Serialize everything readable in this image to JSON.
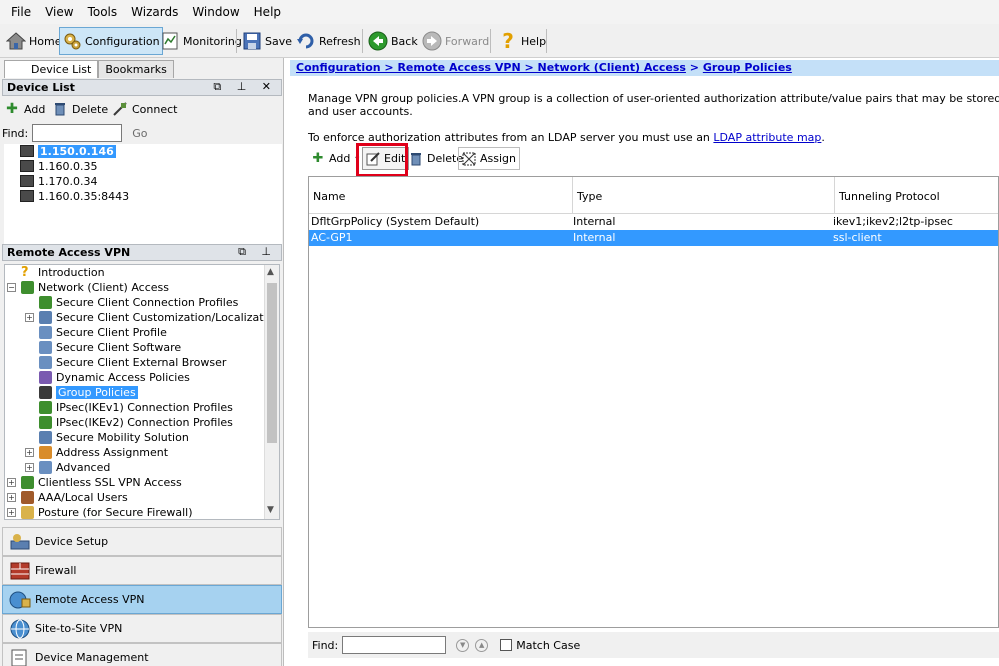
{
  "menu": [
    "File",
    "View",
    "Tools",
    "Wizards",
    "Window",
    "Help"
  ],
  "toolbar": {
    "home": "Home",
    "configuration": "Configuration",
    "monitoring": "Monitoring",
    "save": "Save",
    "refresh": "Refresh",
    "back": "Back",
    "forward": "Forward",
    "help": "Help"
  },
  "left": {
    "tabs": [
      "Device List",
      "Bookmarks"
    ],
    "device_list_title": "Device List",
    "add": "Add",
    "delete": "Delete",
    "connect": "Connect",
    "find_label": "Find:",
    "go": "Go",
    "devices": [
      "1.150.0.146",
      "1.160.0.35",
      "1.170.0.34",
      "1.160.0.35:8443"
    ],
    "rav_title": "Remote Access VPN",
    "tree": [
      "Introduction",
      "Network (Client) Access",
      "Secure Client Connection Profiles",
      "Secure Client Customization/Localization",
      "Secure Client Profile",
      "Secure Client Software",
      "Secure Client External Browser",
      "Dynamic Access Policies",
      "Group Policies",
      "IPsec(IKEv1) Connection Profiles",
      "IPsec(IKEv2) Connection Profiles",
      "Secure Mobility Solution",
      "Address Assignment",
      "Advanced",
      "Clientless SSL VPN Access",
      "AAA/Local Users",
      "Posture (for Secure Firewall)"
    ],
    "nav": [
      "Device Setup",
      "Firewall",
      "Remote Access VPN",
      "Site-to-Site VPN",
      "Device Management"
    ]
  },
  "right": {
    "crumb_path": "Configuration > Remote Access VPN > Network (Client) Access",
    "crumb_sep": " > ",
    "crumb_current": "Group Policies",
    "desc_line1": "Manage VPN group policies.A VPN group is a collection of user-oriented authorization attribute/value pairs that may be stored internally on the device or",
    "desc_line2": "and user accounts.",
    "ldap_prefix": "To enforce authorization attributes from an LDAP server you must use an ",
    "ldap_link": "LDAP attribute map",
    "ldap_suffix": ".",
    "grid_buttons": {
      "add": "Add",
      "edit": "Edit",
      "delete": "Delete",
      "assign": "Assign"
    },
    "columns": [
      "Name",
      "Type",
      "Tunneling Protocol"
    ],
    "rows": [
      {
        "name": "DfltGrpPolicy (System Default)",
        "type": "Internal",
        "protocol": "ikev1;ikev2;l2tp-ipsec"
      },
      {
        "name": "AC-GP1",
        "type": "Internal",
        "protocol": "ssl-client"
      }
    ],
    "find_label": "Find:",
    "match_case": "Match Case"
  },
  "colors": {
    "selection": "#3399ff",
    "crumb_bg": "#c4e0f8",
    "highlight": "#e0001a",
    "nav_active": "#a6d2f0"
  }
}
